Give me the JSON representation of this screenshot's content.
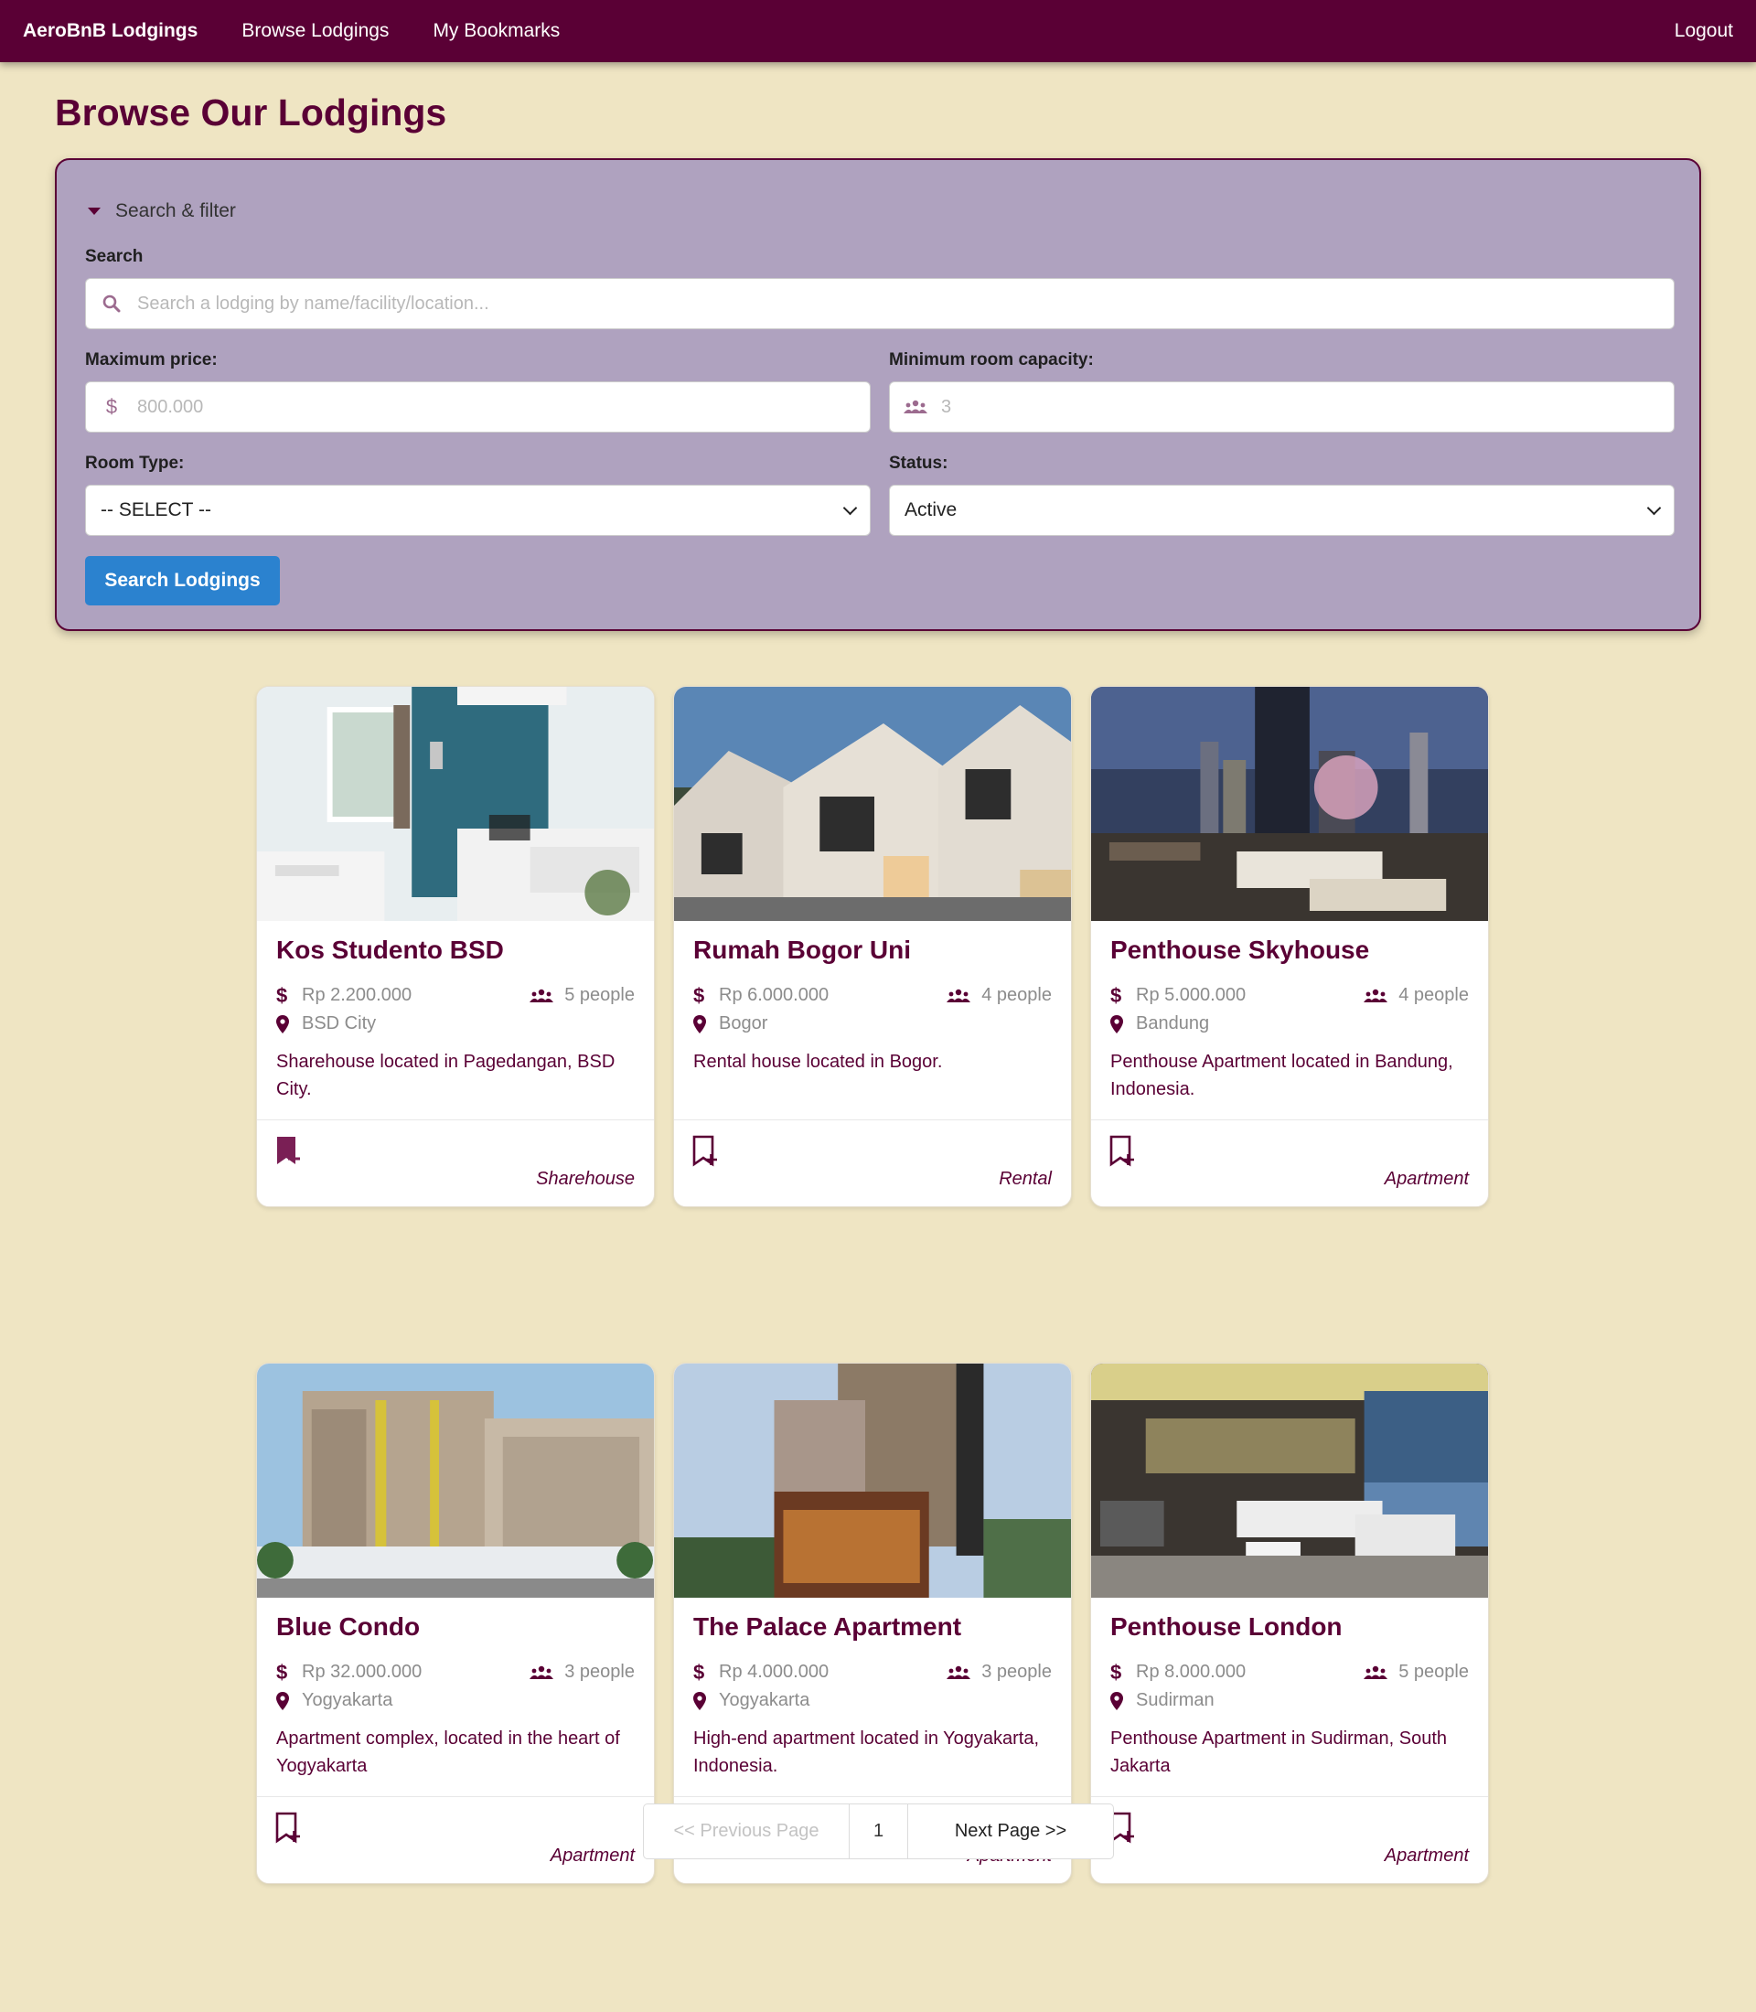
{
  "nav": {
    "brand": "AeroBnB Lodgings",
    "browse": "Browse Lodgings",
    "bookmarks": "My Bookmarks",
    "logout": "Logout"
  },
  "page": {
    "title": "Browse Our Lodgings"
  },
  "filter": {
    "toggle_label": "Search & filter",
    "search_label": "Search",
    "search_placeholder": "Search a lodging by name/facility/location...",
    "max_price_label": "Maximum price:",
    "max_price_placeholder": "800.000",
    "min_capacity_label": "Minimum room capacity:",
    "min_capacity_placeholder": "3",
    "room_type_label": "Room Type:",
    "room_type_value": "-- SELECT --",
    "status_label": "Status:",
    "status_value": "Active",
    "search_button": "Search Lodgings"
  },
  "lodgings": [
    {
      "name": "Kos Studento BSD",
      "price": "Rp 2.200.000",
      "capacity": "5 people",
      "location": "BSD City",
      "description": "Sharehouse located in Pagedangan, BSD City.",
      "type": "Sharehouse",
      "bookmarked": true,
      "image": "bedroom"
    },
    {
      "name": "Rumah Bogor Uni",
      "price": "Rp 6.000.000",
      "capacity": "4 people",
      "location": "Bogor",
      "description": "Rental house located in Bogor.",
      "type": "Rental",
      "bookmarked": false,
      "image": "townhouse"
    },
    {
      "name": "Penthouse Skyhouse",
      "price": "Rp 5.000.000",
      "capacity": "4 people",
      "location": "Bandung",
      "description": "Penthouse Apartment located in Bandung, Indonesia.",
      "type": "Apartment",
      "bookmarked": false,
      "image": "night-terrace"
    },
    {
      "name": "Blue Condo",
      "price": "Rp 32.000.000",
      "capacity": "3 people",
      "location": "Yogyakarta",
      "description": "Apartment complex, located in the heart of Yogyakarta",
      "type": "Apartment",
      "bookmarked": false,
      "image": "condo-building"
    },
    {
      "name": "The Palace Apartment",
      "price": "Rp 4.000.000",
      "capacity": "3 people",
      "location": "Yogyakarta",
      "description": "High-end apartment located in Yogyakarta, Indonesia.",
      "type": "Apartment",
      "bookmarked": false,
      "image": "palace-tower"
    },
    {
      "name": "Penthouse London",
      "price": "Rp 8.000.000",
      "capacity": "5 people",
      "location": "Sudirman",
      "description": "Penthouse Apartment in Sudirman, South Jakarta",
      "type": "Apartment",
      "bookmarked": false,
      "image": "living-room"
    }
  ],
  "pagination": {
    "prev": "<< Previous Page",
    "current": "1",
    "next": "Next Page >>"
  },
  "colors": {
    "primary": "#5a0035",
    "background": "#efe5c3",
    "panel": "#afa2bf",
    "button": "#2b82cf"
  }
}
